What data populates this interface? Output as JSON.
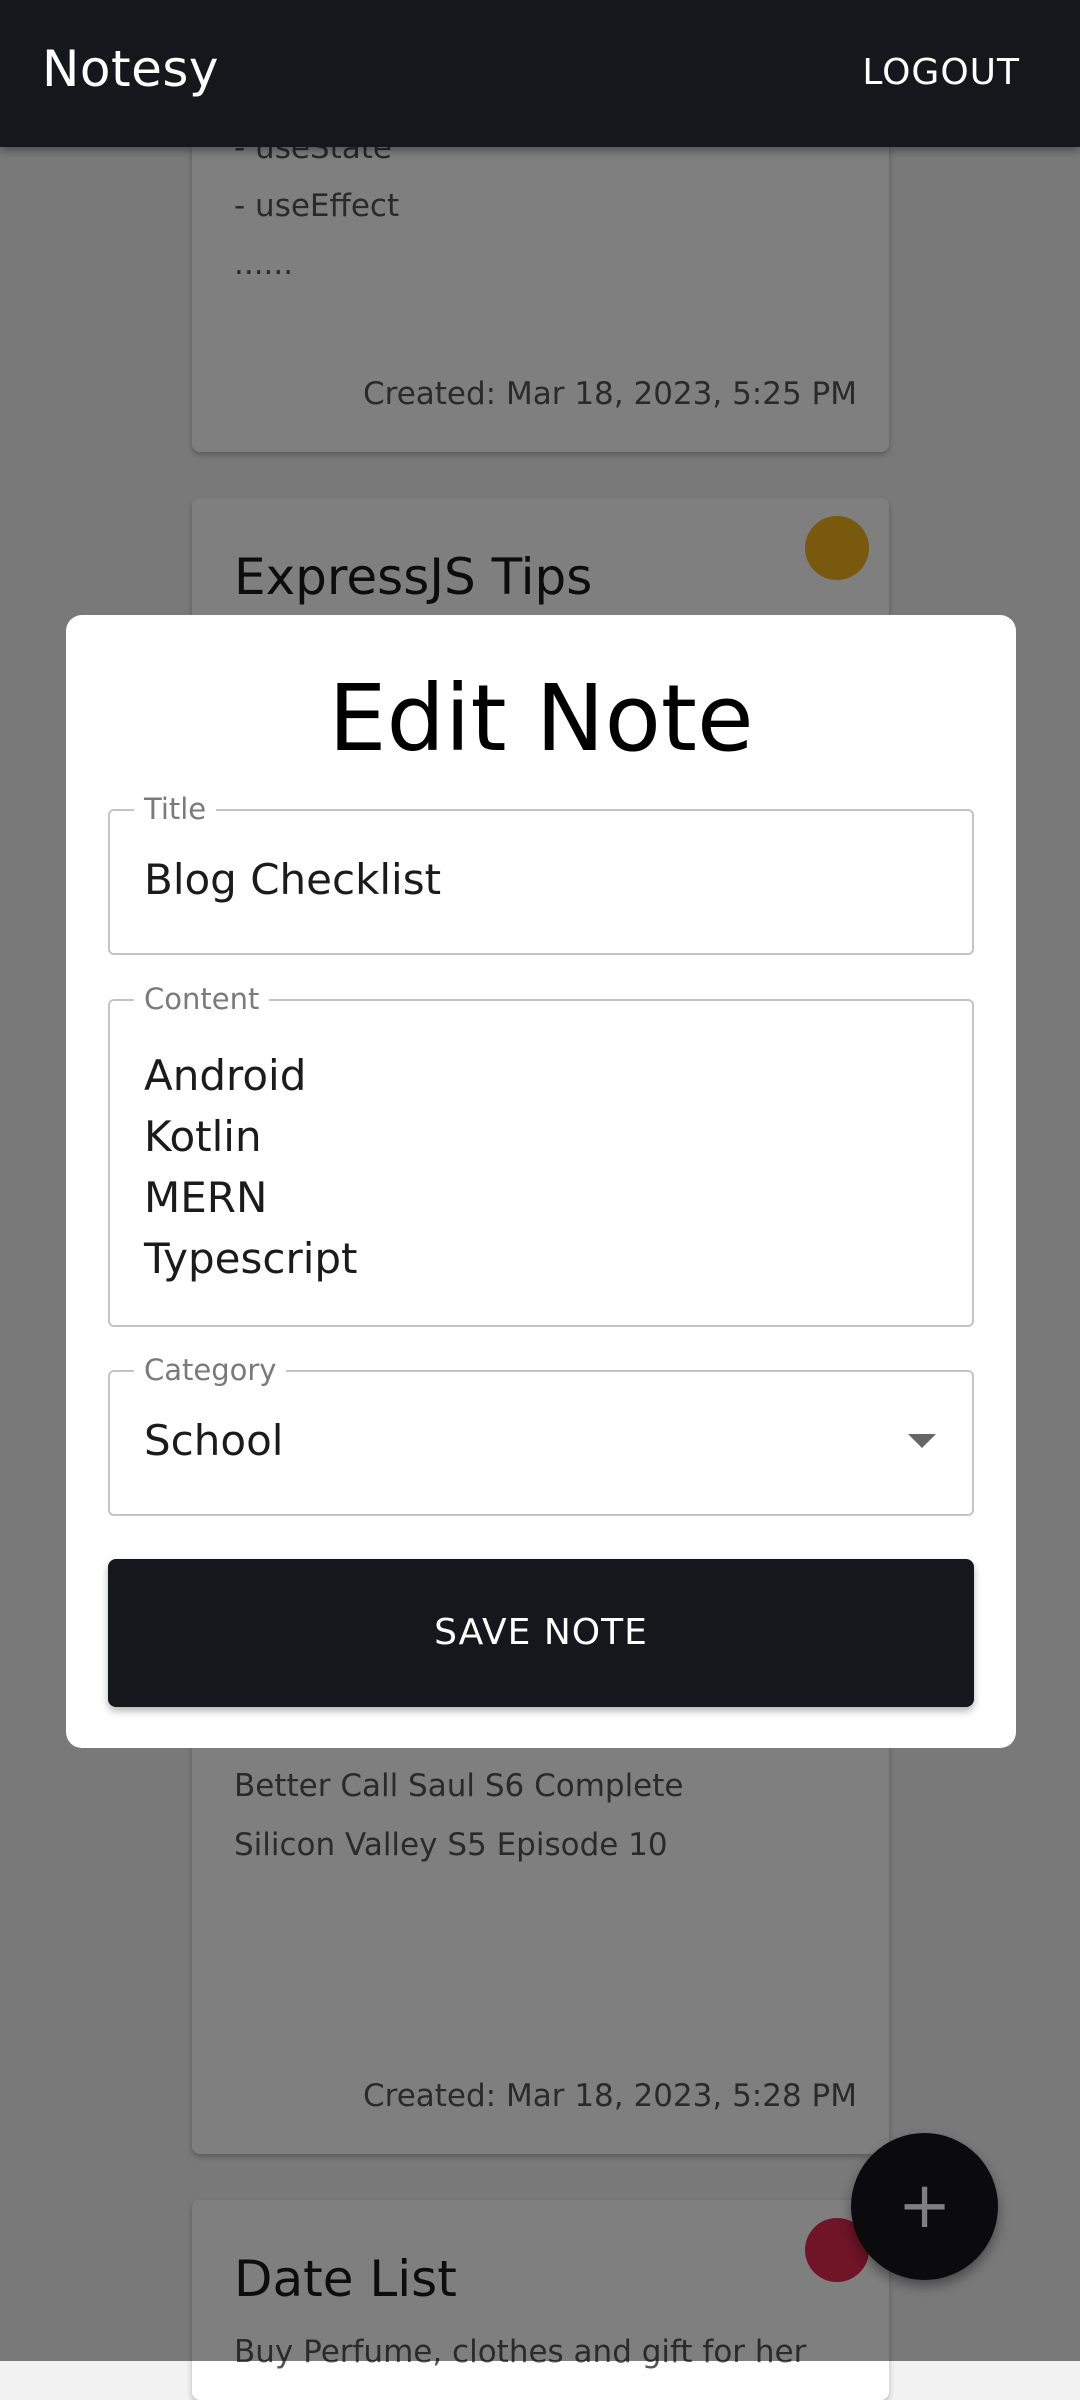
{
  "app_bar": {
    "title": "Notesy",
    "logout_label": "LOGOUT"
  },
  "notes": [
    {
      "content_lines": [
        "- useState",
        "- useEffect",
        "......"
      ],
      "created": "Created: Mar 18, 2023, 5:25 PM"
    },
    {
      "title": "ExpressJS Tips",
      "dot_color": "#f0b31a"
    },
    {
      "content_lines": [
        "Better Call Saul S6 Complete",
        "Silicon Valley S5 Episode 10"
      ],
      "created": "Created: Mar 18, 2023, 5:28 PM"
    },
    {
      "title": "Date List",
      "content_lines": [
        "Buy Perfume, clothes and gift for her"
      ],
      "dot_color": "#e0284f"
    }
  ],
  "modal": {
    "title": "Edit Note",
    "title_field": {
      "label": "Title",
      "value": "Blog Checklist"
    },
    "content_field": {
      "label": "Content",
      "lines": [
        "Android",
        "Kotlin",
        "MERN",
        "Typescript"
      ]
    },
    "category_field": {
      "label": "Category",
      "value": "School",
      "icon": "chevron-down-icon"
    },
    "save_label": "SAVE NOTE"
  },
  "fab": {
    "label": "+",
    "icon": "plus-icon"
  },
  "colors": {
    "app_bar": "#16171d",
    "primary_button": "#16171d",
    "scrim": "rgba(0,0,0,0.5)"
  }
}
